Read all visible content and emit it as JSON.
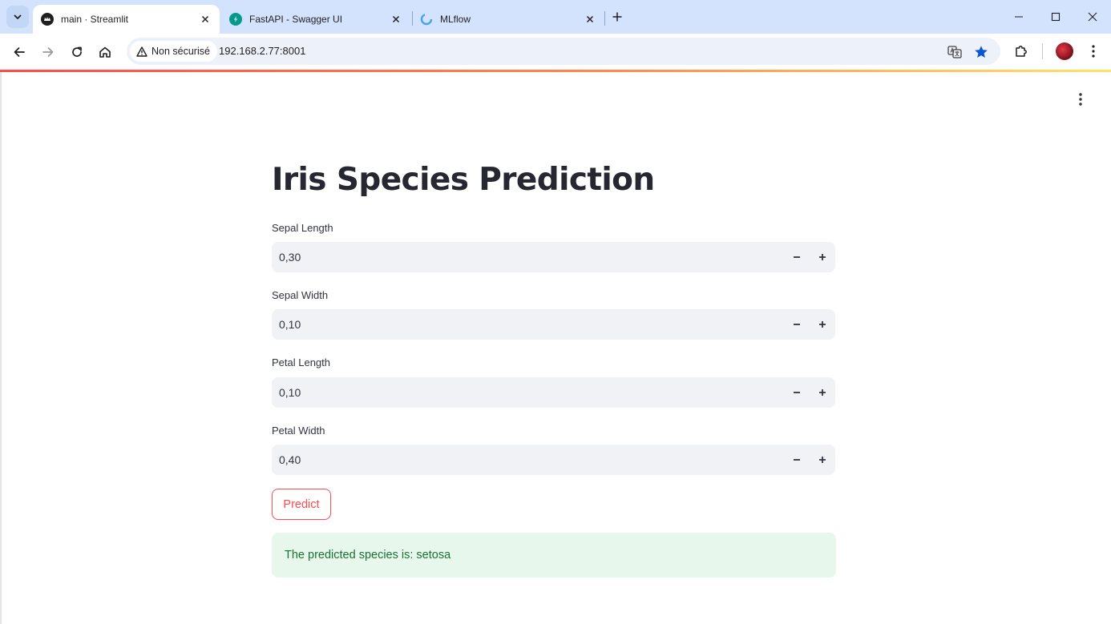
{
  "browser": {
    "tabs": [
      {
        "title": "main · Streamlit",
        "active": true,
        "favicon": "streamlit-crown-icon"
      },
      {
        "title": "FastAPI - Swagger UI",
        "active": false,
        "favicon": "fastapi-bolt-icon"
      },
      {
        "title": "MLflow",
        "active": false,
        "favicon": "mlflow-loading-icon"
      }
    ],
    "security_chip": "Non sécurisé",
    "url": "192.168.2.77:8001",
    "colors": {
      "tabstrip": "#d3e3fd",
      "omnibox": "#edf1fa",
      "bookmark_star": "#0b57d0"
    }
  },
  "app": {
    "title": "Iris Species Prediction",
    "fields": [
      {
        "label": "Sepal Length",
        "value": "0,30"
      },
      {
        "label": "Sepal Width",
        "value": "0,10"
      },
      {
        "label": "Petal Length",
        "value": "0,10"
      },
      {
        "label": "Petal Width",
        "value": "0,40"
      }
    ],
    "stepper_minus": "−",
    "stepper_plus": "+",
    "predict_label": "Predict",
    "result_text": "The predicted species is: setosa",
    "colors": {
      "primary": "#ff4b4b",
      "input_bg": "#f0f2f6",
      "success_bg": "#e8f7ec",
      "success_text": "#177233",
      "title": "#262730"
    }
  }
}
